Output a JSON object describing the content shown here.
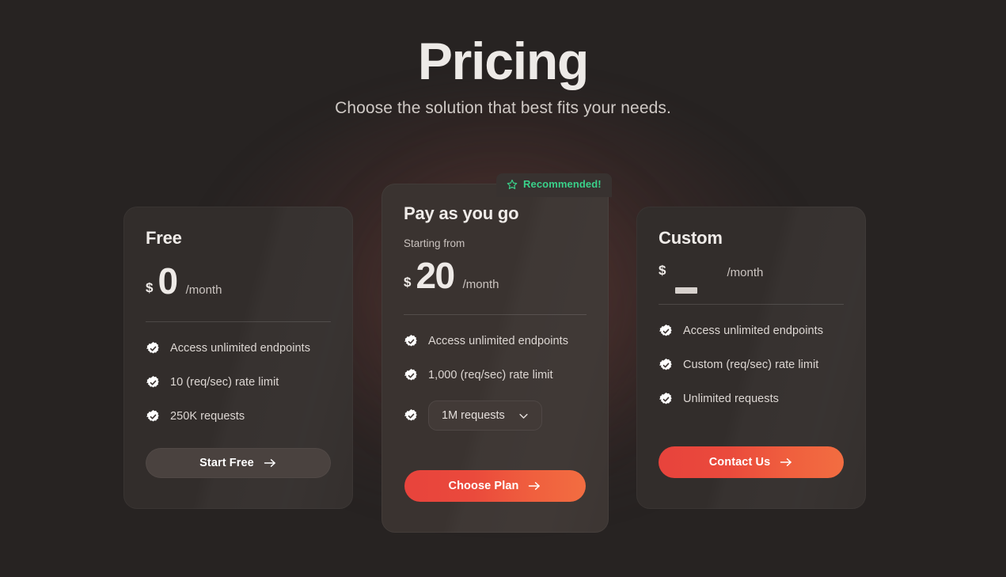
{
  "header": {
    "title": "Pricing",
    "subtitle": "Choose the solution that best fits your needs."
  },
  "badge": {
    "label": "Recommended!",
    "icon": "star-icon",
    "color": "#3ad18a"
  },
  "colors": {
    "page_background": "#272322",
    "card_background": "#322d2b",
    "card_background_featured": "#3a3330",
    "text_primary": "#edeae7",
    "text_secondary": "#cfc9c5",
    "cta_gradient_start": "#e8433c",
    "cta_gradient_end": "#f26d41",
    "ghost_button": "#4a423f",
    "accent_green": "#3ad18a"
  },
  "plans": [
    {
      "id": "free",
      "name": "Free",
      "starting_from": "",
      "currency": "$",
      "amount": "0",
      "period": "/month",
      "features": [
        {
          "icon": "check-badge-icon",
          "label": "Access unlimited endpoints"
        },
        {
          "icon": "check-badge-icon",
          "label": "10 (req/sec) rate limit"
        },
        {
          "icon": "check-badge-icon",
          "label": "250K requests"
        }
      ],
      "cta": {
        "label": "Start Free",
        "icon": "arrow-right-icon",
        "style": "ghost"
      }
    },
    {
      "id": "pay-as-you-go",
      "name": "Pay as you go",
      "starting_from": "Starting from",
      "currency": "$",
      "amount": "20",
      "period": "/month",
      "features": [
        {
          "icon": "check-badge-icon",
          "label": "Access unlimited endpoints"
        },
        {
          "icon": "check-badge-icon",
          "label": "1,000 (req/sec) rate limit"
        }
      ],
      "requests_select": {
        "value": "1M requests",
        "icon": "chevron-down-icon",
        "options": [
          "1M requests"
        ]
      },
      "cta": {
        "label": "Choose Plan",
        "icon": "arrow-right-icon",
        "style": "primary"
      }
    },
    {
      "id": "custom",
      "name": "Custom",
      "starting_from": "",
      "currency": "$",
      "amount": "",
      "period": "/month",
      "features": [
        {
          "icon": "check-badge-icon",
          "label": "Access unlimited endpoints"
        },
        {
          "icon": "check-badge-icon",
          "label": "Custom (req/sec) rate limit"
        },
        {
          "icon": "check-badge-icon",
          "label": "Unlimited requests"
        }
      ],
      "cta": {
        "label": "Contact Us",
        "icon": "arrow-right-icon",
        "style": "primary"
      }
    }
  ]
}
